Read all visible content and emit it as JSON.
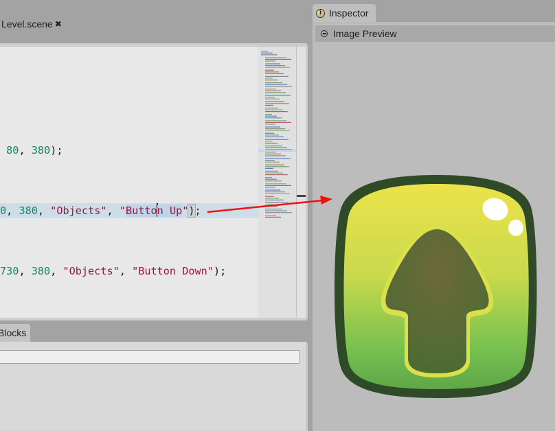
{
  "editor": {
    "tab_label": "Level.scene",
    "tab_close_icon": "close-icon",
    "lines": [
      {
        "segments": [
          {
            "t": " "
          },
          {
            "t": "80",
            "c": "num"
          },
          {
            "t": ", "
          },
          {
            "t": "380",
            "c": "num"
          },
          {
            "t": ");"
          }
        ]
      },
      {
        "highlighted": true,
        "segments": [
          {
            "t": "0",
            "c": "num"
          },
          {
            "t": ", "
          },
          {
            "t": "380",
            "c": "num"
          },
          {
            "t": ", "
          },
          {
            "t": "\"Objects\"",
            "c": "str"
          },
          {
            "t": ", "
          },
          {
            "t": "\"",
            "c": "str"
          },
          {
            "t": "Butto",
            "c": "str sel"
          },
          {
            "caret": true
          },
          {
            "t": "n Up",
            "c": "str sel"
          },
          {
            "t": "\"",
            "c": "str"
          },
          {
            "t": ")",
            "c": "bracket"
          },
          {
            "t": ";"
          }
        ]
      },
      {
        "segments": [
          {
            "t": "730",
            "c": "num"
          },
          {
            "t": ", "
          },
          {
            "t": "380",
            "c": "num"
          },
          {
            "t": ", "
          },
          {
            "t": "\"Objects\"",
            "c": "str"
          },
          {
            "t": ", "
          },
          {
            "t": "\"Button Down\"",
            "c": "str"
          },
          {
            "t": ");"
          }
        ]
      }
    ]
  },
  "bottom_panel": {
    "tab_label": "Blocks",
    "search_value": ""
  },
  "inspector": {
    "tab_label": "Inspector",
    "tab_icon": "info-icon",
    "section_label": "Image Preview",
    "section_icon": "collapse-icon",
    "preview_image": "button-up-arrow-green",
    "colors": {
      "outline": "#2f4a26",
      "top": "#ece34a",
      "bottom": "#6cbf4e",
      "arrow": "#6a6a36"
    }
  },
  "annotation": {
    "type": "arrow",
    "color": "#ee1111"
  }
}
